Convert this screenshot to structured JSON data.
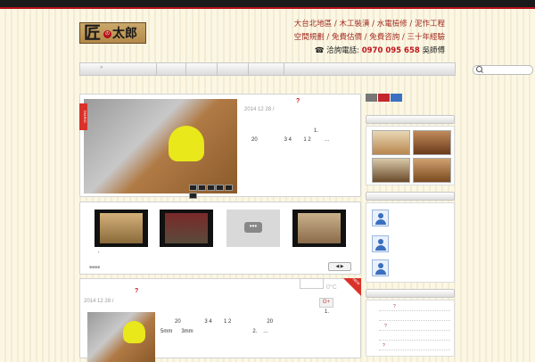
{
  "logo": {
    "main_char": "匠",
    "mark": "の",
    "name": "太郎"
  },
  "header": {
    "tagline_1": "大台北地區 / 木工裝潢 / 水電檢修 / 泥作工程",
    "tagline_2": "空間規劃 / 免費估價 / 免費咨詢 / 三十年經驗",
    "phone_label": "洽詢電話:",
    "phone_number": "0970 095 658",
    "phone_contact": "吳師傅"
  },
  "nav": {
    "arrow": "»"
  },
  "post1": {
    "date": "2014 12 28  /",
    "title_mark": "?",
    "excerpt_line1": "1.",
    "excerpt_line2": "20                  3 4        1 2         …",
    "ribbon": "DIARIO"
  },
  "gallery": {
    "more_label": "•••",
    "caption": ",",
    "dots": "■■■■",
    "nav": "◀ ▶"
  },
  "post2": {
    "date": "2014 12 28  /",
    "title_mark": "?",
    "temp": "0°C",
    "gplus": "G+",
    "ribbon": "NEW",
    "line1": "1.",
    "line2": "20                3 4        1 2                        20",
    "line3": "5mm      3mm                                        2.    …"
  },
  "sidebar": {
    "share_colors": [
      "#777777",
      "#c3262c",
      "#3b6fc1"
    ],
    "list_marks": [
      "?",
      "?",
      "?"
    ]
  }
}
